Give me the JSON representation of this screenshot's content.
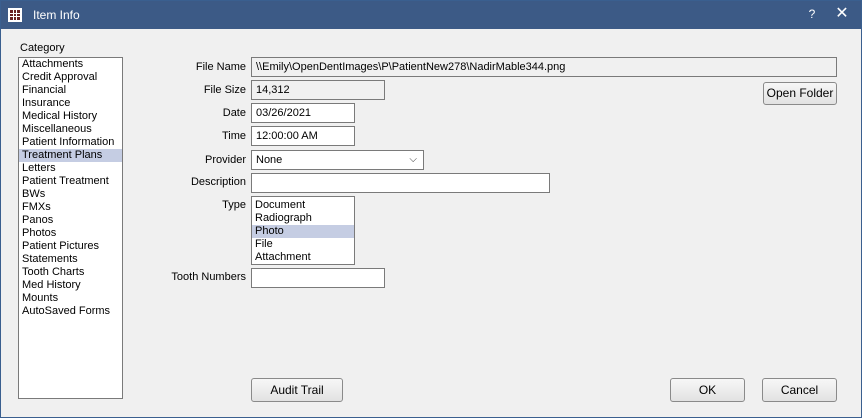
{
  "window": {
    "title": "Item Info",
    "help_label": "?",
    "close_label": "✕"
  },
  "category": {
    "label": "Category",
    "items": [
      "Attachments",
      "Credit Approval",
      "Financial",
      "Insurance",
      "Medical History",
      "Miscellaneous",
      "Patient Information",
      "Treatment Plans",
      "Letters",
      "Patient Treatment",
      "BWs",
      "FMXs",
      "Panos",
      "Photos",
      "Patient Pictures",
      "Statements",
      "Tooth Charts",
      "Med History",
      "Mounts",
      "AutoSaved Forms"
    ],
    "selected": "Treatment Plans"
  },
  "fields": {
    "file_name_label": "File Name",
    "file_name_value": "\\\\Emily\\OpenDentImages\\P\\PatientNew278\\NadirMable344.png",
    "file_size_label": "File Size",
    "file_size_value": "14,312",
    "date_label": "Date",
    "date_value": "03/26/2021",
    "time_label": "Time",
    "time_value": "12:00:00 AM",
    "provider_label": "Provider",
    "provider_value": "None",
    "description_label": "Description",
    "description_value": "",
    "type_label": "Type",
    "type_options": [
      "Document",
      "Radiograph",
      "Photo",
      "File",
      "Attachment"
    ],
    "type_selected": "Photo",
    "tooth_numbers_label": "Tooth Numbers",
    "tooth_numbers_value": ""
  },
  "buttons": {
    "open_folder": "Open Folder",
    "audit_trail": "Audit Trail",
    "ok": "OK",
    "cancel": "Cancel"
  },
  "colors": {
    "titlebar": "#3c5a86",
    "selection": "#c5cde3"
  }
}
